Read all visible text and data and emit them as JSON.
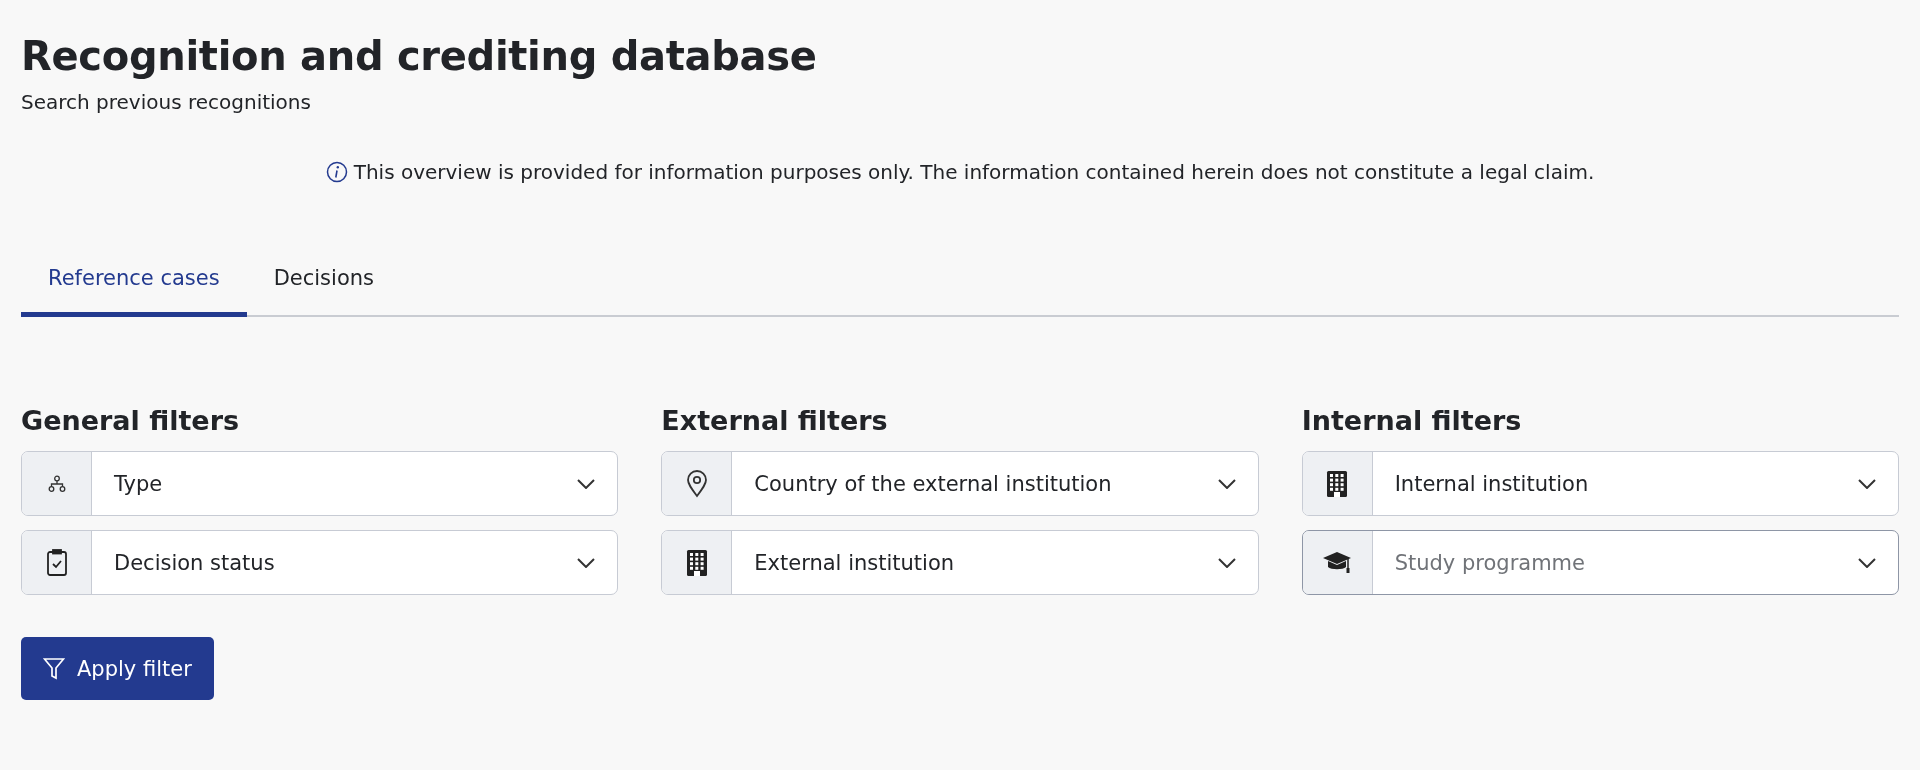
{
  "page": {
    "title": "Recognition and crediting database",
    "subtitle": "Search previous recognitions"
  },
  "notice": {
    "text": "This overview is provided for information purposes only. The information contained herein does not constitute a legal claim."
  },
  "tabs": [
    {
      "label": "Reference cases",
      "selected": true
    },
    {
      "label": "Decisions",
      "selected": false
    }
  ],
  "filter_groups": [
    {
      "heading": "General filters",
      "fields": [
        {
          "value": "Type",
          "focused": false
        },
        {
          "value": "Decision status",
          "focused": false
        }
      ]
    },
    {
      "heading": "External filters",
      "fields": [
        {
          "value": "Country of the external institution",
          "focused": false
        },
        {
          "value": "External institution",
          "focused": false
        }
      ]
    },
    {
      "heading": "Internal filters",
      "fields": [
        {
          "value": "Internal institution",
          "focused": false
        },
        {
          "placeholder": "Study programme",
          "focused": true
        }
      ]
    }
  ],
  "apply_button": {
    "label": "Apply filter"
  }
}
